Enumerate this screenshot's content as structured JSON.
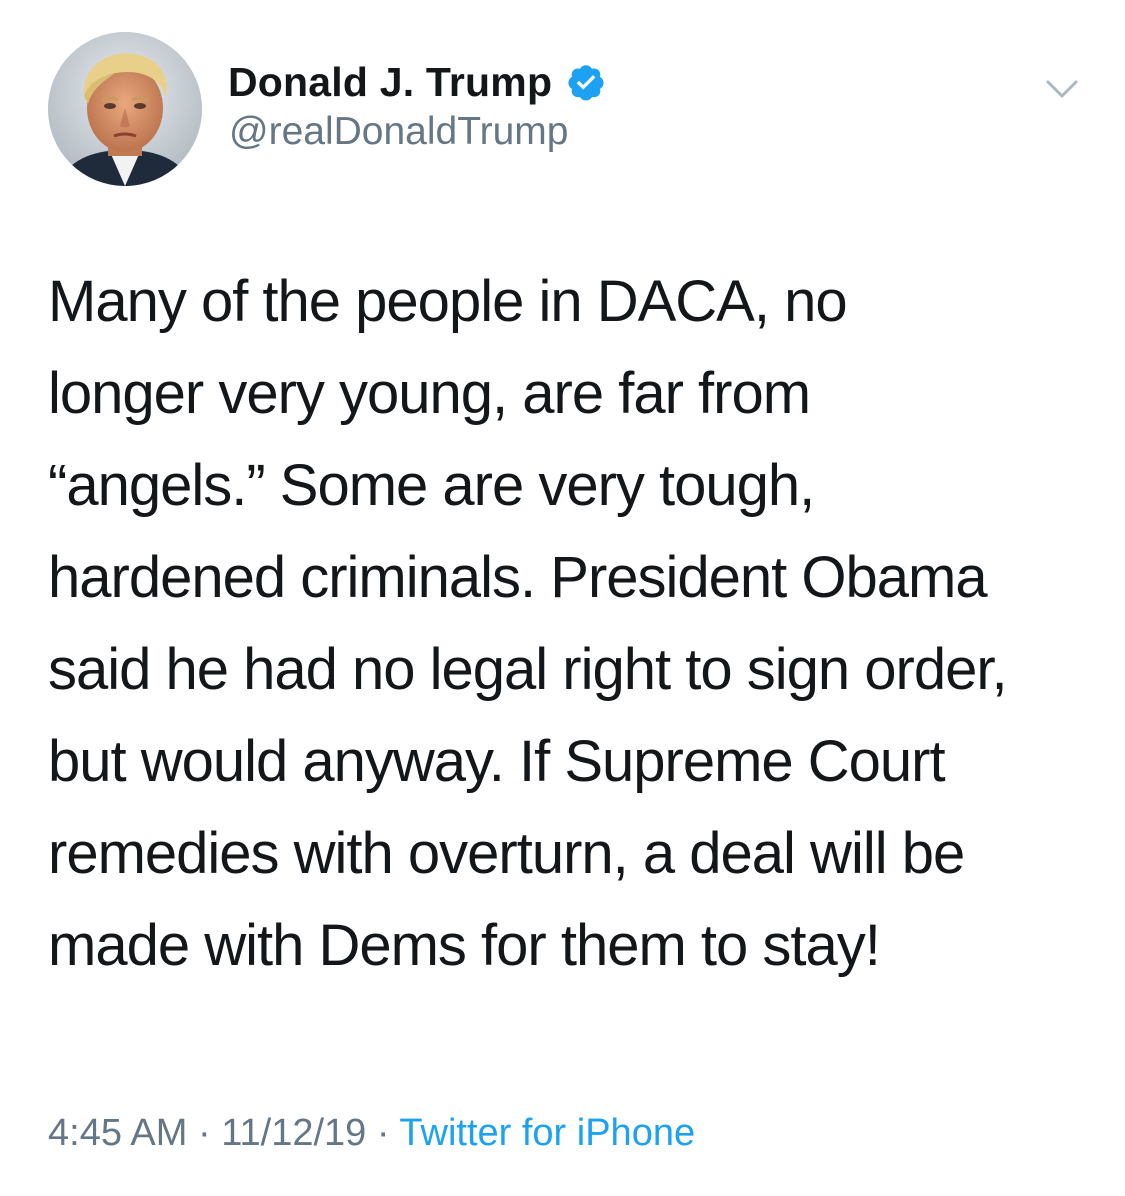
{
  "user": {
    "display_name": "Donald J. Trump",
    "handle": "@realDonaldTrump",
    "verified_icon": "verified-badge-icon",
    "avatar_icon": "profile-photo"
  },
  "menu_icon": "chevron-down-icon",
  "tweet": {
    "lines": [
      "Many of the people in DACA, no",
      "longer very young, are far from",
      "“angels.” Some are very tough,",
      "hardened criminals. President Obama",
      "said he had no legal right to sign order,",
      "but would anyway. If Supreme Court",
      "remedies with overturn, a deal will be",
      "made with Dems for them to stay!"
    ]
  },
  "meta": {
    "time": "4:45 AM",
    "separator": "·",
    "date": "11/12/19",
    "source": "Twitter for iPhone"
  },
  "colors": {
    "text": "#14171a",
    "secondary": "#657786",
    "link": "#1da1f2",
    "verified": "#1da1f2"
  }
}
